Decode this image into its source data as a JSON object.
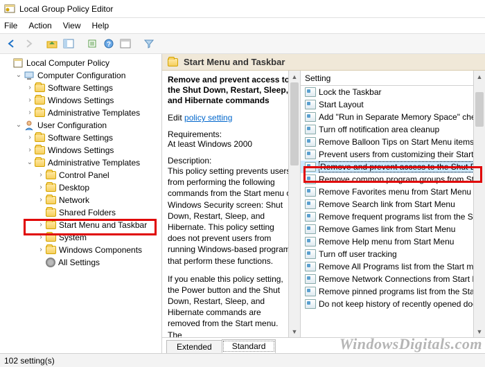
{
  "window": {
    "title": "Local Group Policy Editor"
  },
  "menu": {
    "file": "File",
    "action": "Action",
    "view": "View",
    "help": "Help"
  },
  "tree": {
    "root": "Local Computer Policy",
    "cc": "Computer Configuration",
    "cc_sw": "Software Settings",
    "cc_ws": "Windows Settings",
    "cc_at": "Administrative Templates",
    "uc": "User Configuration",
    "uc_sw": "Software Settings",
    "uc_ws": "Windows Settings",
    "uc_at": "Administrative Templates",
    "uc_at_cp": "Control Panel",
    "uc_at_desktop": "Desktop",
    "uc_at_network": "Network",
    "uc_at_shared": "Shared Folders",
    "uc_at_start": "Start Menu and Taskbar",
    "uc_at_system": "System",
    "uc_at_wc": "Windows Components",
    "uc_at_all": "All Settings"
  },
  "header": {
    "title": "Start Menu and Taskbar"
  },
  "desc": {
    "title": "Remove and prevent access to the Shut Down, Restart, Sleep, and Hibernate commands",
    "edit_prefix": "Edit ",
    "edit_link": "policy setting",
    "req_label": "Requirements:",
    "req_value": "At least Windows 2000",
    "desc_label": "Description:",
    "desc_body1": "This policy setting prevents users from performing the following commands from the Start menu or Windows Security screen: Shut Down, Restart, Sleep, and Hibernate. This policy setting does not prevent users from running Windows-based programs that perform these functions.",
    "desc_body2": "If you enable this policy setting, the Power button and the Shut Down, Restart, Sleep, and Hibernate commands are removed from the Start menu. The"
  },
  "list": {
    "col": "Setting",
    "items": [
      "Lock the Taskbar",
      "Start Layout",
      "Add \"Run in Separate Memory Space\" check",
      "Turn off notification area cleanup",
      "Remove Balloon Tips on Start Menu items",
      "Prevent users from customizing their Start",
      "Remove and prevent access to the Shut Do",
      "Remove common program groups from Sta",
      "Remove Favorites menu from Start Menu",
      "Remove Search link from Start Menu",
      "Remove frequent programs list from the Sta",
      "Remove Games link from Start Menu",
      "Remove Help menu from Start Menu",
      "Turn off user tracking",
      "Remove All Programs list from the Start me",
      "Remove Network Connections from Start M",
      "Remove pinned programs list from the Start",
      "Do not keep history of recently opened doc"
    ],
    "selected_index": 6
  },
  "tabs": {
    "extended": "Extended",
    "standard": "Standard"
  },
  "status": {
    "text": "102 setting(s)"
  },
  "watermark": "WindowsDigitals.com"
}
